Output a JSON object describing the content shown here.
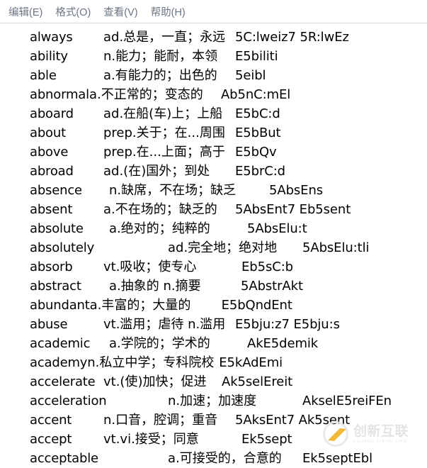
{
  "menubar": {
    "items": [
      {
        "label": "编辑(E)",
        "name": "menu-edit"
      },
      {
        "label": "格式(O)",
        "name": "menu-format"
      },
      {
        "label": "查看(V)",
        "name": "menu-view"
      },
      {
        "label": "帮助(H)",
        "name": "menu-help"
      }
    ]
  },
  "document": {
    "rows": [
      {
        "word": "always",
        "definition": "ad.总是，一直；永远",
        "pronunciation": "5C:lweiz7 5R:lwEz",
        "layout": "normal"
      },
      {
        "word": "ability",
        "definition": "n.能力；能耐，本领",
        "pronunciation": "E5biliti",
        "layout": "normal"
      },
      {
        "word": "able",
        "definition": "a.有能力的；出色的",
        "pronunciation": "5eibl",
        "layout": "normal"
      },
      {
        "word": "abnormal",
        "definition": "a.不正常的；变态的",
        "pronunciation": "Ab5nC:mEl",
        "layout": "wide"
      },
      {
        "word": "aboard",
        "definition": "ad.在船(车)上；上船",
        "pronunciation": "E5bC:d",
        "layout": "normal"
      },
      {
        "word": "about",
        "definition": "prep.关于；在...周围",
        "pronunciation": "E5bBut",
        "layout": "normal"
      },
      {
        "word": "above",
        "definition": "prep.在...上面；高于",
        "pronunciation": "E5bQv",
        "layout": "normal"
      },
      {
        "word": "abroad",
        "definition": "ad.(在)国外；到处",
        "pronunciation": "E5brC:d",
        "layout": "normal"
      },
      {
        "word": "absence",
        "definition": "n.缺席，不在场；缺乏",
        "pronunciation": "5AbsEns",
        "layout": "absence"
      },
      {
        "word": "absent",
        "definition": "a.不在场的；缺乏的",
        "pronunciation": "5AbsEnt7 Eb5sent",
        "layout": "normal"
      },
      {
        "word": "absolute",
        "definition": "a.绝对的；纯粹的",
        "pronunciation": "5AbsElu:t",
        "layout": "absolute"
      },
      {
        "word": "absolutely",
        "definition": "ad.完全地；绝对地",
        "pronunciation": "5AbsElu:tli",
        "layout": "push"
      },
      {
        "word": "absorb",
        "definition": "vt.吸收；使专心",
        "pronunciation": "Eb5sC:b",
        "layout": "absorb"
      },
      {
        "word": "abstract",
        "definition": "a.抽象的 n.摘要",
        "pronunciation": "5AbstrAkt",
        "layout": "abstract"
      },
      {
        "word": "abundant",
        "definition": "a.丰富的；大量的",
        "pronunciation": "E5bQndEnt",
        "layout": "wide"
      },
      {
        "word": "abuse",
        "definition": "vt.滥用；虐待 n.滥用",
        "pronunciation": "E5bju:z7 E5bju:s",
        "layout": "normal"
      },
      {
        "word": "academic",
        "definition": "a.学院的；学术的",
        "pronunciation": "AkE5demik",
        "layout": "academic"
      },
      {
        "word": "academy",
        "definition": "n.私立中学；专科院校",
        "pronunciation": "E5kAdEmi",
        "layout": "wide"
      },
      {
        "word": "accelerate",
        "definition": "vt.(使)加快；促进",
        "pronunciation": "Ak5selEreit",
        "layout": "accelerate"
      },
      {
        "word": "acceleration",
        "definition": "n.加速；加速度",
        "pronunciation": "AkselE5reiFEn",
        "layout": "push"
      },
      {
        "word": "accent",
        "definition": "n.口音，腔调；重音",
        "pronunciation": "5AksEnt7 Ak5sent",
        "layout": "normal"
      },
      {
        "word": "accept",
        "definition": "vt.vi.接受；同意",
        "pronunciation": "Ek5sept",
        "layout": "accept"
      },
      {
        "word": "acceptable",
        "definition": "a.可接受的，合意的",
        "pronunciation": "Ek5septEbl",
        "layout": "push"
      }
    ]
  },
  "watermark": {
    "chinese": "创新互联",
    "english": "CHUANG XIN HU LIAN"
  }
}
